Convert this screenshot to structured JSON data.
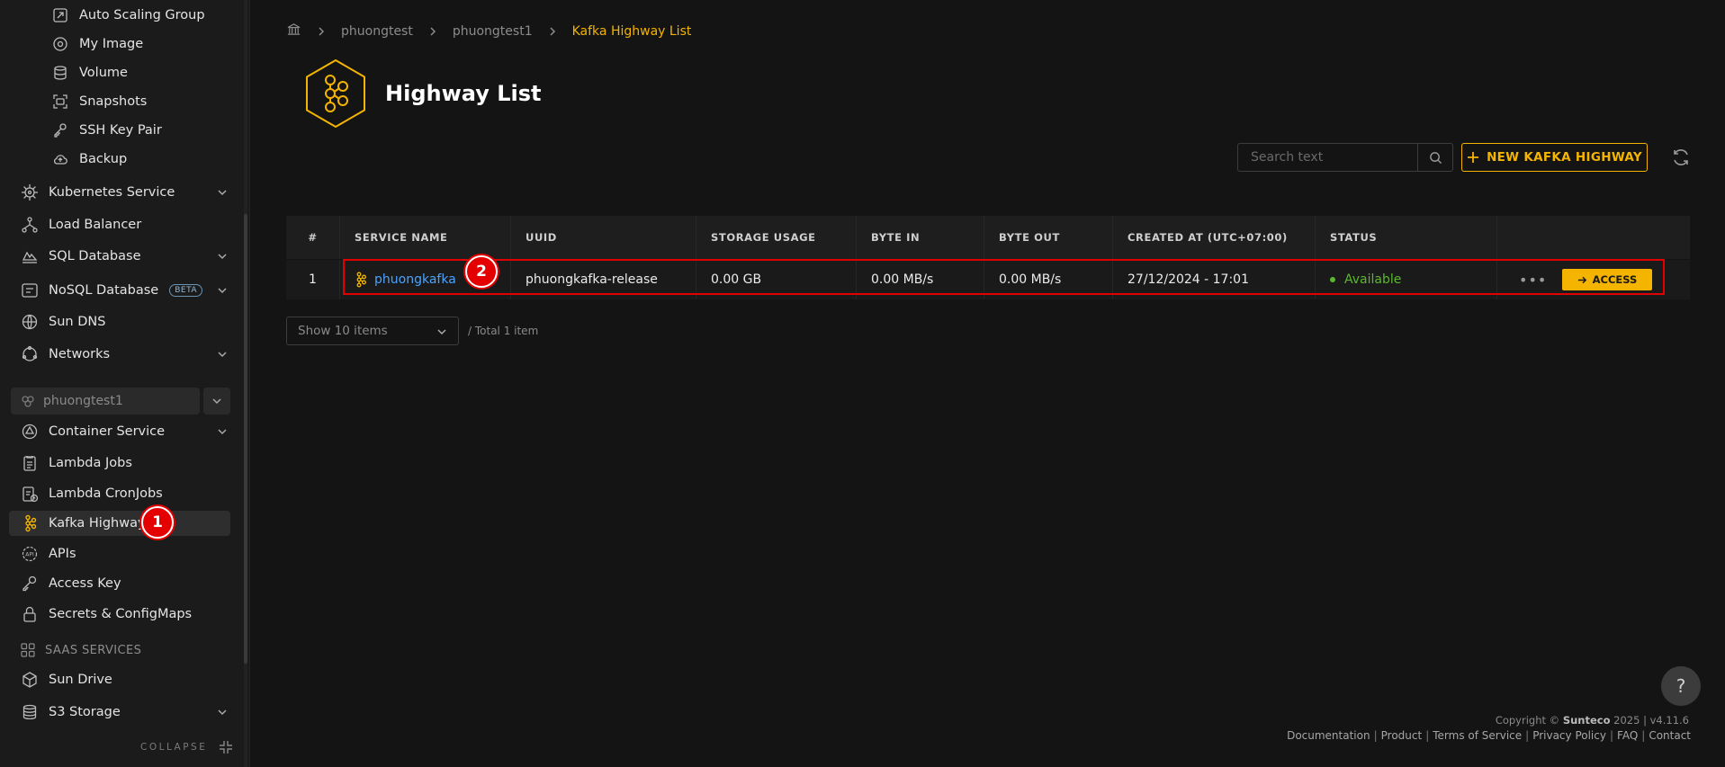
{
  "sidebar": {
    "items": [
      {
        "label": "Auto Scaling Group",
        "icon": "scaling-icon"
      },
      {
        "label": "My Image",
        "icon": "image-icon"
      },
      {
        "label": "Volume",
        "icon": "database-icon"
      },
      {
        "label": "Snapshots",
        "icon": "snapshot-icon"
      },
      {
        "label": "SSH Key Pair",
        "icon": "key-pair-icon"
      },
      {
        "label": "Backup",
        "icon": "cloud-backup-icon"
      },
      {
        "label": "Kubernetes Service",
        "icon": "helm-icon"
      },
      {
        "label": "Load Balancer",
        "icon": "load-balancer-icon"
      },
      {
        "label": "SQL Database",
        "icon": "sql-icon"
      },
      {
        "label": "NoSQL Database",
        "icon": "nosql-icon",
        "badge": "BETA"
      },
      {
        "label": "Sun DNS",
        "icon": "globe-icon"
      },
      {
        "label": "Networks",
        "icon": "network-icon"
      },
      {
        "label": "Container Service",
        "icon": "container-icon"
      },
      {
        "label": "Lambda Jobs",
        "icon": "jobs-icon"
      },
      {
        "label": "Lambda CronJobs",
        "icon": "cronjobs-icon"
      },
      {
        "label": "Kafka Highway",
        "icon": "kafka-icon"
      },
      {
        "label": "APIs",
        "icon": "api-icon"
      },
      {
        "label": "Access Key",
        "icon": "key-icon"
      },
      {
        "label": "Secrets & ConfigMaps",
        "icon": "lock-icon"
      },
      {
        "label": "Sun Drive",
        "icon": "box-icon"
      },
      {
        "label": "S3 Storage",
        "icon": "storage-icon"
      }
    ],
    "project": "phuongtest1",
    "saas_header": "SAAS SERVICES",
    "collapse_label": "COLLAPSE"
  },
  "markers": {
    "one": "1",
    "two": "2"
  },
  "breadcrumb": {
    "level1": "phuongtest",
    "level2": "phuongtest1",
    "current": "Kafka Highway List"
  },
  "page": {
    "title": "Highway List"
  },
  "toolbar": {
    "search_placeholder": "Search text",
    "new_button": "NEW KAFKA HIGHWAY"
  },
  "table": {
    "headers": [
      "#",
      "SERVICE NAME",
      "UUID",
      "STORAGE USAGE",
      "BYTE IN",
      "BYTE OUT",
      "CREATED AT (UTC+07:00)",
      "STATUS",
      ""
    ],
    "rows": [
      {
        "index": "1",
        "name": "phuongkafka",
        "uuid": "phuongkafka-release",
        "storage": "0.00 GB",
        "byte_in": "0.00 MB/s",
        "byte_out": "0.00 MB/s",
        "created": "27/12/2024 - 17:01",
        "status": "Available",
        "action": "ACCESS"
      }
    ]
  },
  "pagination": {
    "page_size": "Show 10 items",
    "total": "/ Total 1 item"
  },
  "help": "?",
  "footer": {
    "copyright_prefix": "Copyright ©",
    "brand": "Sunteco",
    "copyright_suffix": "2025 | v4.11.6",
    "links": [
      "Documentation",
      "Product",
      "Terms of Service",
      "Privacy Policy",
      "FAQ",
      "Contact"
    ]
  },
  "colors": {
    "accent": "#f4b400",
    "link": "#4aa3ff",
    "status_ok": "#5ab82c",
    "marker": "#e40000"
  }
}
